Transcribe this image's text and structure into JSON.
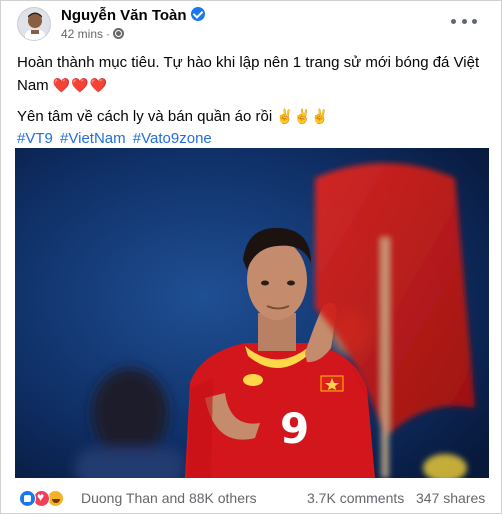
{
  "post": {
    "author": "Nguyễn Văn Toàn",
    "time": "42 mins",
    "dot": "·",
    "line1": "Hoàn thành mục tiêu. Tự hào khi lập nên 1 trang sử mới bóng đá Việt Nam",
    "hearts": "❤️❤️❤️",
    "line2": "Yên tâm về cách ly và bán quần áo rồi",
    "victory": "✌️✌️✌️",
    "hashtags": [
      "#VT9",
      "#VietNam",
      "#Vato9zone"
    ],
    "jersey_number": "9"
  },
  "footer": {
    "reactions_text": "Duong Than and 88K others",
    "comments": "3.7K comments",
    "shares": "347 shares"
  },
  "icons": [
    "verified-icon",
    "globe-icon",
    "more-options-icon",
    "like-reaction-icon",
    "love-reaction-icon",
    "haha-reaction-icon"
  ],
  "colors": {
    "link": "#216fdb",
    "verified": "#1877f2",
    "meta": "#65676b",
    "jersey": "#d3161c",
    "photo_bg": "#0c2a5c"
  }
}
